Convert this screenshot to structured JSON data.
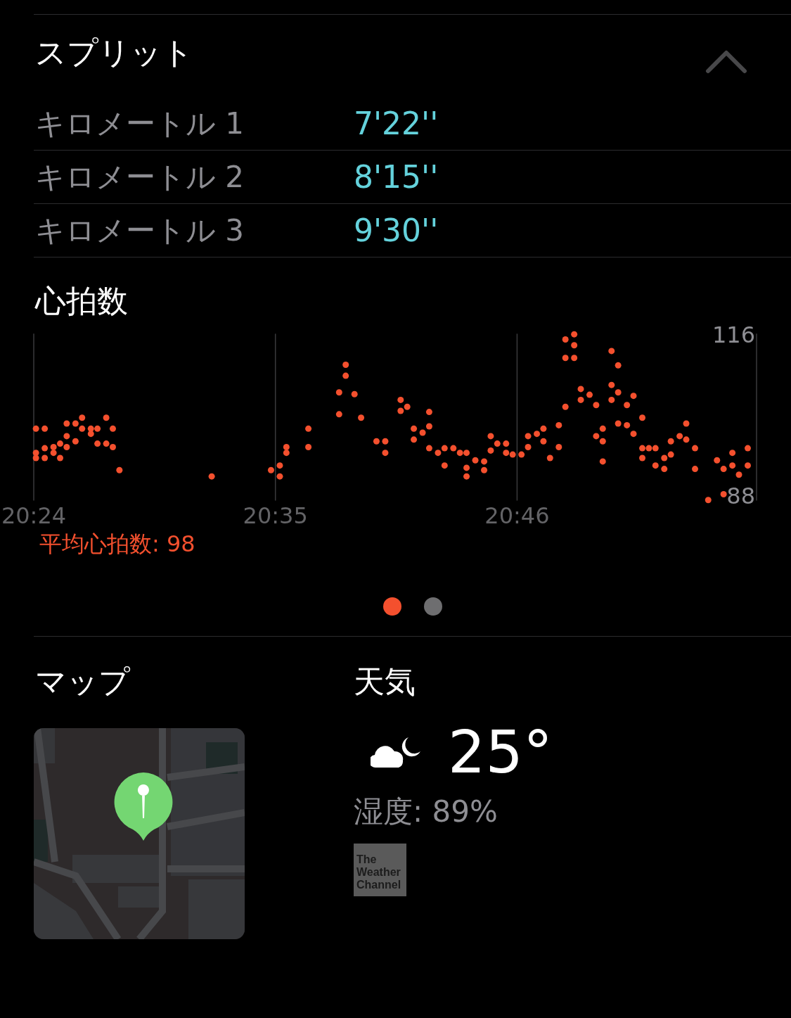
{
  "splits": {
    "title": "スプリット",
    "expanded": true,
    "rows": [
      {
        "label": "キロメートル 1",
        "pace": "7'22''"
      },
      {
        "label": "キロメートル 2",
        "pace": "8'15''"
      },
      {
        "label": "キロメートル 3",
        "pace": "9'30''"
      }
    ]
  },
  "heart_rate": {
    "chart_data": {
      "type": "scatter",
      "title": "心拍数",
      "xlim": [
        1224,
        1256.9
      ],
      "ylim": [
        87.2,
        116.2
      ],
      "xticks": [
        {
          "value": 1224,
          "label": "20:24"
        },
        {
          "value": 1235,
          "label": "20:35"
        },
        {
          "value": 1246,
          "label": "20:46"
        }
      ],
      "yticks": [
        116,
        88
      ],
      "x": [
        1224.1,
        1224.5,
        1224.1,
        1224.1,
        1224.5,
        1224.5,
        1224.9,
        1224.9,
        1225.2,
        1225.2,
        1225.5,
        1225.5,
        1225.5,
        1225.9,
        1225.9,
        1226.2,
        1226.2,
        1226.6,
        1226.6,
        1226.9,
        1226.9,
        1227.3,
        1227.3,
        1227.6,
        1227.6,
        1227.9,
        1232.1,
        1234.8,
        1235.2,
        1235.2,
        1235.5,
        1235.5,
        1236.5,
        1236.5,
        1237.9,
        1237.9,
        1238.2,
        1238.2,
        1238.6,
        1238.9,
        1239.6,
        1240,
        1240,
        1240.7,
        1240.7,
        1241,
        1241.3,
        1241.3,
        1241.7,
        1242,
        1242,
        1242,
        1242.4,
        1242.7,
        1242.7,
        1243.1,
        1243.4,
        1243.7,
        1243.7,
        1243.7,
        1244.1,
        1244.5,
        1244.5,
        1244.8,
        1244.8,
        1245.1,
        1245.5,
        1245.5,
        1245.8,
        1246.2,
        1246.5,
        1246.5,
        1246.9,
        1247.2,
        1247.2,
        1247.5,
        1247.9,
        1247.9,
        1248.2,
        1248.2,
        1248.2,
        1248.6,
        1248.6,
        1248.6,
        1248.9,
        1248.9,
        1249.3,
        1249.6,
        1249.6,
        1249.9,
        1249.9,
        1249.9,
        1250.3,
        1250.3,
        1250.3,
        1250.6,
        1250.6,
        1250.6,
        1251,
        1251,
        1251.3,
        1251.3,
        1251.7,
        1251.7,
        1251.7,
        1252,
        1252.3,
        1252.3,
        1252.7,
        1252.7,
        1253,
        1253,
        1253.4,
        1253.7,
        1253.7,
        1254.1,
        1254.1,
        1254.7,
        1255.1,
        1255.4,
        1255.4,
        1255.8,
        1255.8,
        1256.1,
        1256.5,
        1256.5
      ],
      "series": [
        {
          "color": "#f4502e",
          "values": [
            99.7,
            99.7,
            95.5,
            94.6,
            96.3,
            94.6,
            96.5,
            95.5,
            97.1,
            94.6,
            100.6,
            98.4,
            96.5,
            100.6,
            97.5,
            101.6,
            99.7,
            99.7,
            98.8,
            99.7,
            97.1,
            101.6,
            97.1,
            99.7,
            96.5,
            92.5,
            91.4,
            92.5,
            93.3,
            91.4,
            96.5,
            95.5,
            99.7,
            96.5,
            106,
            102.2,
            110.8,
            108.9,
            105.7,
            101.6,
            97.5,
            97.5,
            95.5,
            104.7,
            102.8,
            103.5,
            99.7,
            97.8,
            99,
            102.6,
            100.1,
            96.3,
            95.5,
            96.3,
            93.3,
            96.3,
            95.5,
            95.5,
            92.9,
            91.4,
            94.2,
            94,
            92.5,
            98.4,
            95.9,
            97.1,
            97.1,
            95.5,
            95.2,
            95.2,
            98.4,
            96.5,
            98.8,
            99.7,
            97.5,
            94.6,
            100.3,
            96.5,
            103.5,
            115.2,
            112,
            116.1,
            114.2,
            112,
            106.6,
            104.7,
            105.6,
            103.8,
            98.4,
            99.7,
            97.5,
            94,
            113.2,
            107.3,
            104.7,
            110.7,
            106,
            100.6,
            103.8,
            100.3,
            105.4,
            98.8,
            101.6,
            96.3,
            94.6,
            96.3,
            96.3,
            93.3,
            94.6,
            92.7,
            97.5,
            95.2,
            98.4,
            100.6,
            97.8,
            96.3,
            92.7,
            87.3,
            94.2,
            92.7,
            88.3,
            95.5,
            93.3,
            91.7,
            96.3,
            93.3
          ]
        }
      ]
    },
    "average": "平均心拍数: 98"
  },
  "pager": [
    {
      "selected": true
    },
    {
      "selected": false
    }
  ],
  "map": {
    "title": "マップ"
  },
  "weather": {
    "title": "天気",
    "temperature": "25°",
    "humidity": "湿度: 89%",
    "logo": "The Weather Channel"
  }
}
